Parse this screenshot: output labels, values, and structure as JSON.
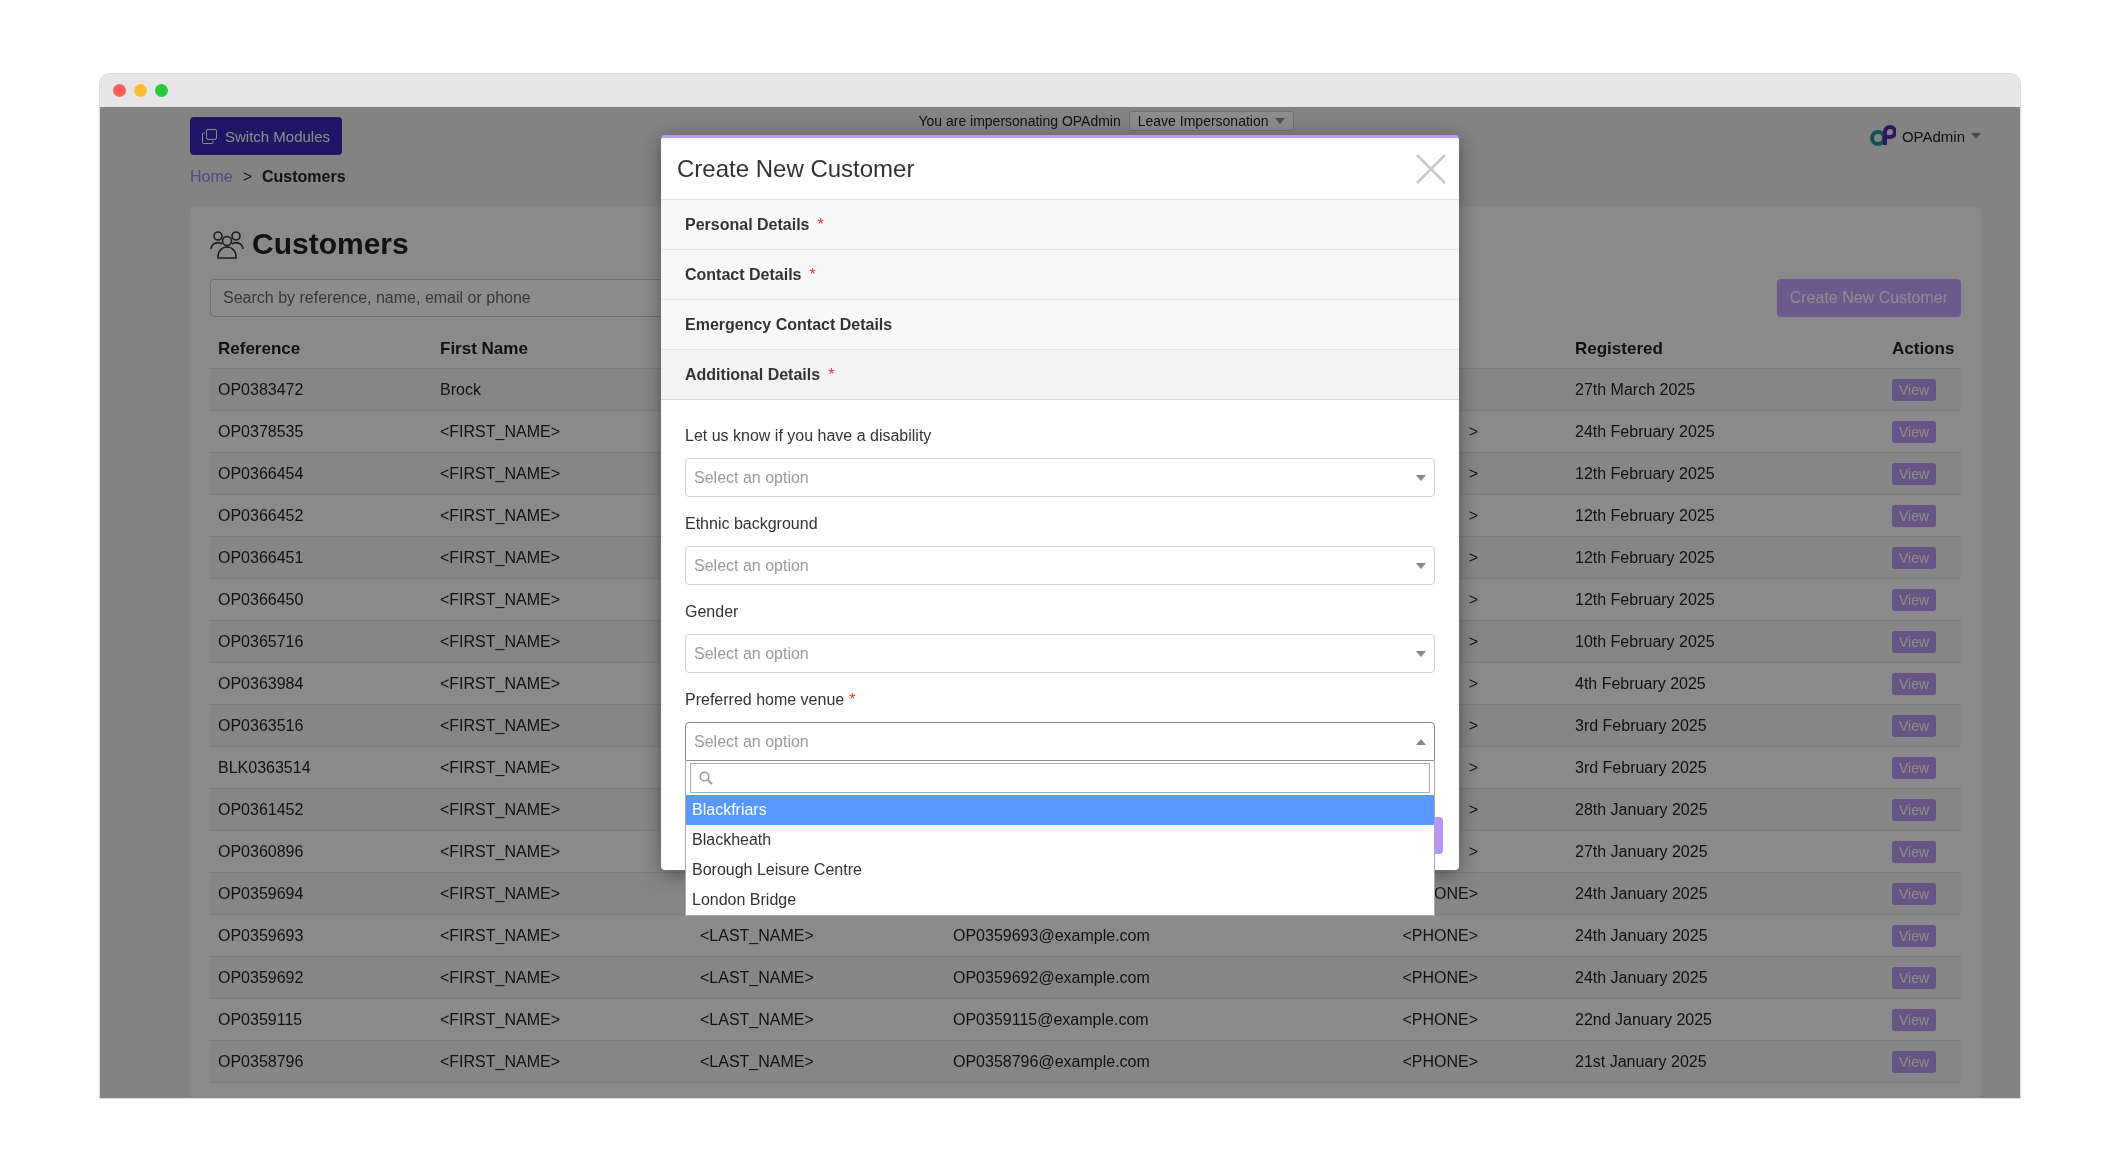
{
  "topbar": {
    "switch_button": "Switch Modules",
    "impersonation": {
      "text": "You are impersonating OPAdmin",
      "button": "Leave Impersonation"
    },
    "user": "OPAdmin"
  },
  "breadcrumb": {
    "separator": ">",
    "items": [
      {
        "label": "Home",
        "link": true
      },
      {
        "label": "Customers",
        "link": false
      }
    ]
  },
  "page": {
    "title": "Customers",
    "search": {
      "placeholder": "Search by reference, name, email or phone"
    },
    "create_button": "Create New Customer"
  },
  "table": {
    "columns": {
      "reference": "Reference",
      "first_name": "First Name",
      "registered": "Registered",
      "actions": "Actions"
    },
    "rows": [
      {
        "reference": "OP0383472",
        "first_name": "Brock",
        "registered": "27th March 2025",
        "action": "View"
      },
      {
        "reference": "OP0378535",
        "first_name": "<FIRST_NAME>",
        "phone": ">",
        "registered": "24th February 2025",
        "action": "View"
      },
      {
        "reference": "OP0366454",
        "first_name": "<FIRST_NAME>",
        "phone": ">",
        "registered": "12th February 2025",
        "action": "View"
      },
      {
        "reference": "OP0366452",
        "first_name": "<FIRST_NAME>",
        "phone": ">",
        "registered": "12th February 2025",
        "action": "View"
      },
      {
        "reference": "OP0366451",
        "first_name": "<FIRST_NAME>",
        "phone": ">",
        "registered": "12th February 2025",
        "action": "View"
      },
      {
        "reference": "OP0366450",
        "first_name": "<FIRST_NAME>",
        "phone": ">",
        "registered": "12th February 2025",
        "action": "View"
      },
      {
        "reference": "OP0365716",
        "first_name": "<FIRST_NAME>",
        "phone": ">",
        "registered": "10th February 2025",
        "action": "View"
      },
      {
        "reference": "OP0363984",
        "first_name": "<FIRST_NAME>",
        "phone": ">",
        "registered": "4th February 2025",
        "action": "View"
      },
      {
        "reference": "OP0363516",
        "first_name": "<FIRST_NAME>",
        "phone": ">",
        "registered": "3rd February 2025",
        "action": "View"
      },
      {
        "reference": "BLK0363514",
        "first_name": "<FIRST_NAME>",
        "phone": ">",
        "registered": "3rd February 2025",
        "action": "View"
      },
      {
        "reference": "OP0361452",
        "first_name": "<FIRST_NAME>",
        "phone": ">",
        "registered": "28th January 2025",
        "action": "View"
      },
      {
        "reference": "OP0360896",
        "first_name": "<FIRST_NAME>",
        "phone": ">",
        "registered": "27th January 2025",
        "action": "View"
      },
      {
        "reference": "OP0359694",
        "first_name": "<FIRST_NAME>",
        "phone": "ONE>",
        "registered": "24th January 2025",
        "action": "View"
      },
      {
        "reference": "OP0359693",
        "first_name": "<FIRST_NAME>",
        "last_name": "<LAST_NAME>",
        "email": "OP0359693@example.com",
        "phone": "<PHONE>",
        "registered": "24th January 2025",
        "action": "View"
      },
      {
        "reference": "OP0359692",
        "first_name": "<FIRST_NAME>",
        "last_name": "<LAST_NAME>",
        "email": "OP0359692@example.com",
        "phone": "<PHONE>",
        "registered": "24th January 2025",
        "action": "View"
      },
      {
        "reference": "OP0359115",
        "first_name": "<FIRST_NAME>",
        "last_name": "<LAST_NAME>",
        "email": "OP0359115@example.com",
        "phone": "<PHONE>",
        "registered": "22nd January 2025",
        "action": "View"
      },
      {
        "reference": "OP0358796",
        "first_name": "<FIRST_NAME>",
        "last_name": "<LAST_NAME>",
        "email": "OP0358796@example.com",
        "phone": "<PHONE>",
        "registered": "21st January 2025",
        "action": "View"
      }
    ]
  },
  "modal": {
    "title": "Create New Customer",
    "sections": [
      {
        "label": "Personal Details",
        "marker": "*",
        "expanded": false
      },
      {
        "label": "Contact Details",
        "marker": "*",
        "expanded": false
      },
      {
        "label": "Emergency Contact Details",
        "expanded": false
      },
      {
        "label": "Additional Details",
        "marker": "*",
        "expanded": true,
        "fields": [
          {
            "label": "Let us know if you have a disability",
            "placeholder": "Select an option",
            "open": false
          },
          {
            "label": "Ethnic background",
            "placeholder": "Select an option",
            "open": false
          },
          {
            "label": "Gender",
            "placeholder": "Select an option",
            "open": false
          },
          {
            "label": "Preferred home venue",
            "marker": "*",
            "placeholder": "Select an option",
            "open": true,
            "options": [
              {
                "label": "Blackfriars",
                "selected": true
              },
              {
                "label": "Blackheath",
                "selected": false
              },
              {
                "label": "Borough Leisure Centre",
                "selected": false
              },
              {
                "label": "London Bridge",
                "selected": false
              }
            ]
          }
        ]
      }
    ]
  }
}
